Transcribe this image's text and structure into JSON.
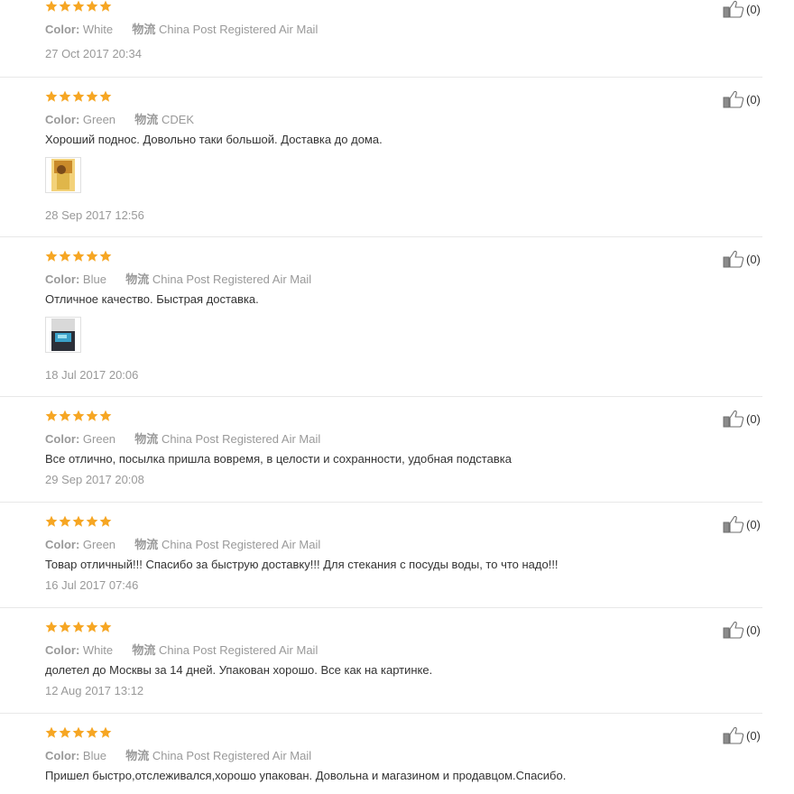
{
  "colors": {
    "star": "#f6a623",
    "muted": "#999999",
    "text": "#333333",
    "divider": "#e8e8e8"
  },
  "labels": {
    "color_key": "Color:",
    "shipping_key": "物流"
  },
  "reviews": [
    {
      "stars": 5,
      "color": "White",
      "shipping": "China Post Registered Air Mail",
      "text": "",
      "date": "27 Oct 2017 20:34",
      "likes": "(0)",
      "has_photo": false
    },
    {
      "stars": 5,
      "color": "Green",
      "shipping": "CDEK",
      "text": "Хороший поднос. Довольно таки большой. Доставка до дома.",
      "date": "28 Sep 2017 12:56",
      "likes": "(0)",
      "has_photo": true
    },
    {
      "stars": 5,
      "color": "Blue",
      "shipping": "China Post Registered Air Mail",
      "text": "Отличное качество. Быстрая доставка.",
      "date": "18 Jul 2017 20:06",
      "likes": "(0)",
      "has_photo": true
    },
    {
      "stars": 5,
      "color": "Green",
      "shipping": "China Post Registered Air Mail",
      "text": "Все отлично, посылка пришла вовремя, в целости и сохранности, удобная подставка",
      "date": "29 Sep 2017 20:08",
      "likes": "(0)",
      "has_photo": false
    },
    {
      "stars": 5,
      "color": "Green",
      "shipping": "China Post Registered Air Mail",
      "text": "Товар отличный!!! Спасибо за быструю доставку!!! Для стекания с посуды воды, то что надо!!!",
      "date": "16 Jul 2017 07:46",
      "likes": "(0)",
      "has_photo": false
    },
    {
      "stars": 5,
      "color": "White",
      "shipping": "China Post Registered Air Mail",
      "text": "долетел до Москвы за 14 дней. Упакован хорошо. Все как на картинке.",
      "date": "12 Aug 2017 13:12",
      "likes": "(0)",
      "has_photo": false
    },
    {
      "stars": 5,
      "color": "Blue",
      "shipping": "China Post Registered Air Mail",
      "text": "Пришел быстро,отслеживался,хорошо упакован. Довольна и магазином и продавцом.Спасибо.",
      "date": "",
      "likes": "(0)",
      "has_photo": false
    }
  ]
}
